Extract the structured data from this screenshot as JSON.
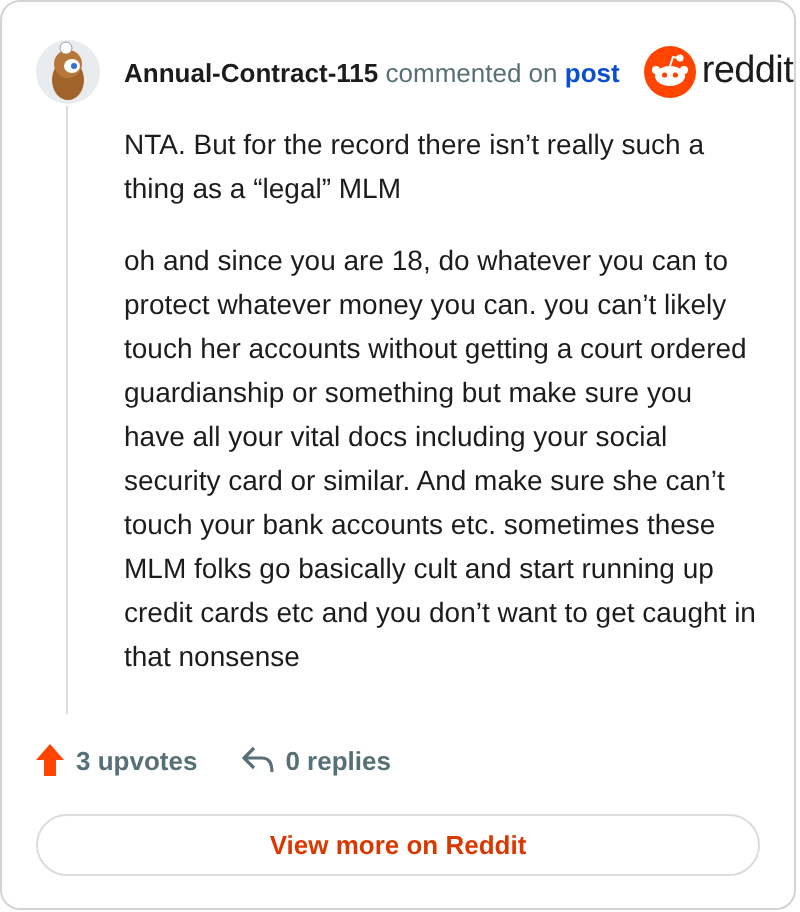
{
  "header": {
    "username": "Annual-Contract-115",
    "action": "commented on",
    "link": "post",
    "brand": "reddit"
  },
  "paragraphs": [
    "NTA. But for the record there isn’t really such a thing as a “legal” MLM",
    "oh and since you are 18, do whatever you can to protect whatever money you can. you can’t likely touch her accounts without getting a court ordered guardianship or something but make sure you have all your vital docs including your social security card or similar. And make sure she can’t touch your bank accounts etc. sometimes these MLM folks go basically cult and start running up credit cards etc and you don’t want to get caught in that nonsense"
  ],
  "footer": {
    "upvotes": "3 upvotes",
    "replies": "0 replies"
  },
  "button": "View more on Reddit"
}
